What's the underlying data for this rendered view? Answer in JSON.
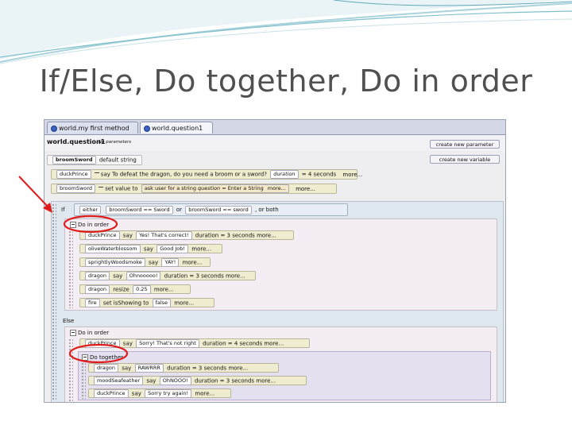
{
  "slide": {
    "title": "If/Else, Do together, Do in order"
  },
  "tabs": [
    {
      "label": "world.my first method"
    },
    {
      "label": "world.question1"
    }
  ],
  "method": {
    "name": "world.question1",
    "params": "No parameters"
  },
  "buttons": {
    "create_param": "create new parameter",
    "create_var": "create new variable"
  },
  "variable": {
    "name": "broomSword",
    "value": "default string"
  },
  "statements": {
    "duck_say": {
      "subject": "duckPrince",
      "verb": "say",
      "text": "To defeat the dragon, do you need a broom or a sword?",
      "dur_label": "duration",
      "dur_value": "= 4 seconds",
      "more": "more..."
    },
    "set_value": {
      "subject": "broomSword",
      "verb": "set value to",
      "ask": "ask user for a string",
      "q_label": "question",
      "q_value": "= Enter a String",
      "more": "more...",
      "more2": "more..."
    }
  },
  "if_block": {
    "keyword": "If",
    "either": "either",
    "cond1_var": "broomSword",
    "cond1_op": "==",
    "cond1_val": "Sword",
    "or": "or",
    "cond2_var": "broomSword",
    "cond2_op": "==",
    "cond2_val": "sword",
    "or_both": ", or both",
    "do_in_order": "Do in order",
    "rows": [
      {
        "subject": "duckPrince",
        "verb": "say",
        "arg": "Yes! That's correct!",
        "extra": "duration = 3 seconds",
        "more": "more..."
      },
      {
        "subject": "oliveWaterblossom",
        "verb": "say",
        "arg": "Good Job!",
        "extra": "",
        "more": "more..."
      },
      {
        "subject": "sprightlyWoodsmoke",
        "verb": "say",
        "arg": "YAY!",
        "extra": "",
        "more": "more..."
      },
      {
        "subject": "dragon",
        "verb": "say",
        "arg": "Ohnooooo!",
        "extra": "duration = 3 seconds",
        "more": "more..."
      },
      {
        "subject": "dragon",
        "verb": "resize",
        "arg": "0.25",
        "extra": "",
        "more": "more..."
      },
      {
        "subject": "fire",
        "verb": "set isShowing to",
        "arg": "false",
        "extra": "",
        "more": "more..."
      }
    ]
  },
  "else_block": {
    "keyword": "Else",
    "do_in_order": "Do in order",
    "row1": {
      "subject": "duckPrince",
      "verb": "say",
      "arg": "Sorry! That's not right",
      "extra": "duration = 4 seconds",
      "more": "more..."
    },
    "do_together": "Do together",
    "rows": [
      {
        "subject": "dragon",
        "verb": "say",
        "arg": "RAWRRR",
        "extra": "duration = 3 seconds",
        "more": "more..."
      },
      {
        "subject": "moodSeafeather",
        "verb": "say",
        "arg": "OhNOOO!",
        "extra": "duration = 3 seconds",
        "more": "more..."
      },
      {
        "subject": "duckPrince",
        "verb": "say",
        "arg": "Sorry try again!",
        "extra": "",
        "more": "more..."
      }
    ]
  },
  "colors": {
    "annotation_red": "#e01b1b",
    "accent_teal": "#5fa8b8"
  }
}
